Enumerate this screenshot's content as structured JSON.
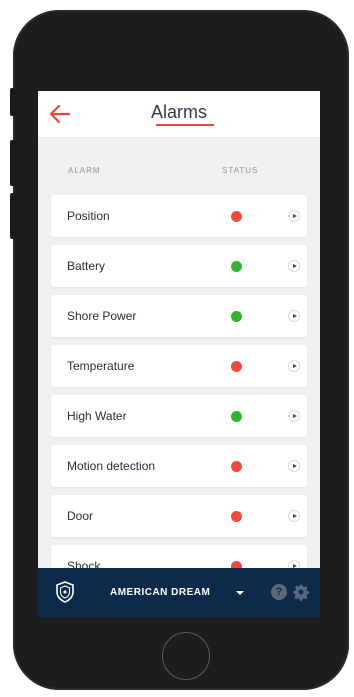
{
  "header": {
    "title": "Alarms",
    "back_icon": "arrow-left-icon",
    "accent_color": "#e8473d"
  },
  "columns": {
    "alarm": "ALARM",
    "status": "STATUS"
  },
  "colors": {
    "ok": "#2db52d",
    "alert": "#f04a3e",
    "footer_bg": "#0e2a4a"
  },
  "alarms": [
    {
      "label": "Position",
      "status": "alert"
    },
    {
      "label": "Battery",
      "status": "ok"
    },
    {
      "label": "Shore Power",
      "status": "ok"
    },
    {
      "label": "Temperature",
      "status": "alert"
    },
    {
      "label": "High Water",
      "status": "ok"
    },
    {
      "label": "Motion detection",
      "status": "alert"
    },
    {
      "label": "Door",
      "status": "alert"
    },
    {
      "label": "Shock",
      "status": "alert"
    }
  ],
  "footer": {
    "boat_name": "AMERICAN DREAM",
    "help_label": "?"
  }
}
